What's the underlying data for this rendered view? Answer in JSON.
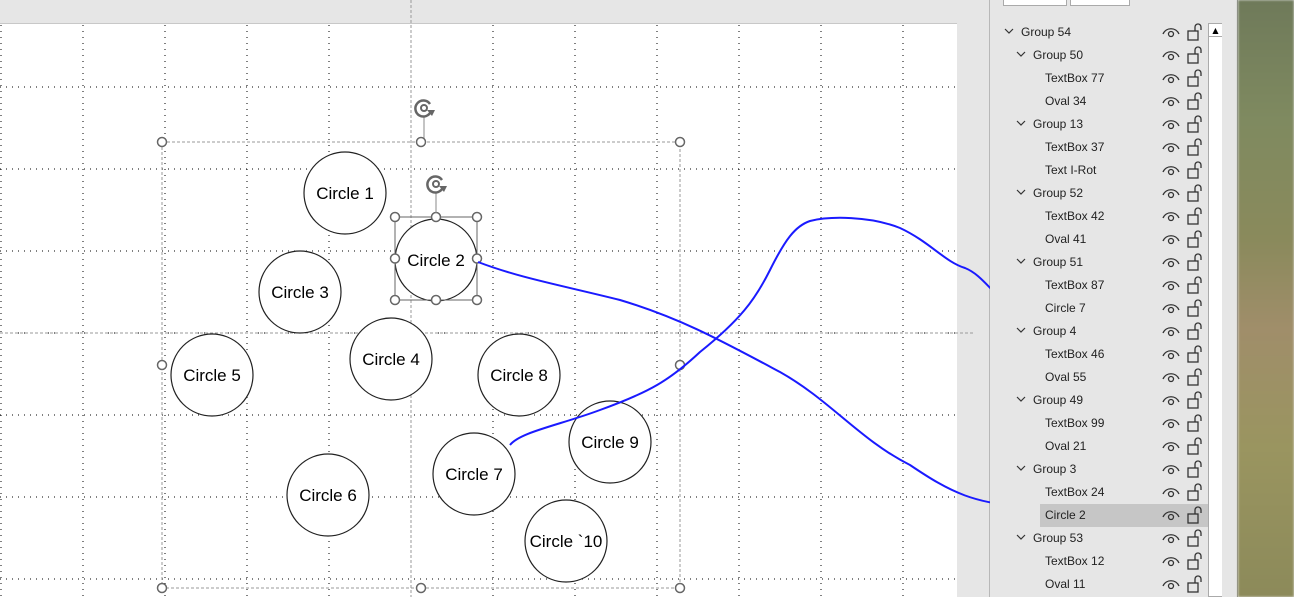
{
  "canvas": {
    "circles": [
      {
        "label": "Circle 1"
      },
      {
        "label": "Circle 2"
      },
      {
        "label": "Circle 3"
      },
      {
        "label": "Circle 4"
      },
      {
        "label": "Circle 5"
      },
      {
        "label": "Circle 8"
      },
      {
        "label": "Circle 9"
      },
      {
        "label": "Circle 6"
      },
      {
        "label": "Circle 7"
      },
      {
        "label": "Circle `10"
      }
    ],
    "annotation_color": "#1a1aff"
  },
  "selection_pane": {
    "items": [
      {
        "label": "Group 54",
        "level": 0,
        "group": true
      },
      {
        "label": "Group 50",
        "level": 1,
        "group": true
      },
      {
        "label": "TextBox 77",
        "level": 2
      },
      {
        "label": "Oval 34",
        "level": 2
      },
      {
        "label": "Group 13",
        "level": 1,
        "group": true
      },
      {
        "label": "TextBox 37",
        "level": 2
      },
      {
        "label": "Text I-Rot",
        "level": 2
      },
      {
        "label": "Group 52",
        "level": 1,
        "group": true
      },
      {
        "label": "TextBox 42",
        "level": 2
      },
      {
        "label": "Oval 41",
        "level": 2
      },
      {
        "label": "Group 51",
        "level": 1,
        "group": true
      },
      {
        "label": "TextBox 87",
        "level": 2
      },
      {
        "label": "Circle 7",
        "level": 2
      },
      {
        "label": "Group 4",
        "level": 1,
        "group": true
      },
      {
        "label": "TextBox 46",
        "level": 2
      },
      {
        "label": "Oval 55",
        "level": 2
      },
      {
        "label": "Group 49",
        "level": 1,
        "group": true
      },
      {
        "label": "TextBox 99",
        "level": 2
      },
      {
        "label": "Oval 21",
        "level": 2
      },
      {
        "label": "Group 3",
        "level": 1,
        "group": true
      },
      {
        "label": "TextBox 24",
        "level": 2
      },
      {
        "label": "Circle 2",
        "level": 2,
        "selected": true
      },
      {
        "label": "Group 53",
        "level": 1,
        "group": true
      },
      {
        "label": "TextBox 12",
        "level": 2
      },
      {
        "label": "Oval 11",
        "level": 2
      }
    ],
    "scroll_up_icon": "▲"
  }
}
